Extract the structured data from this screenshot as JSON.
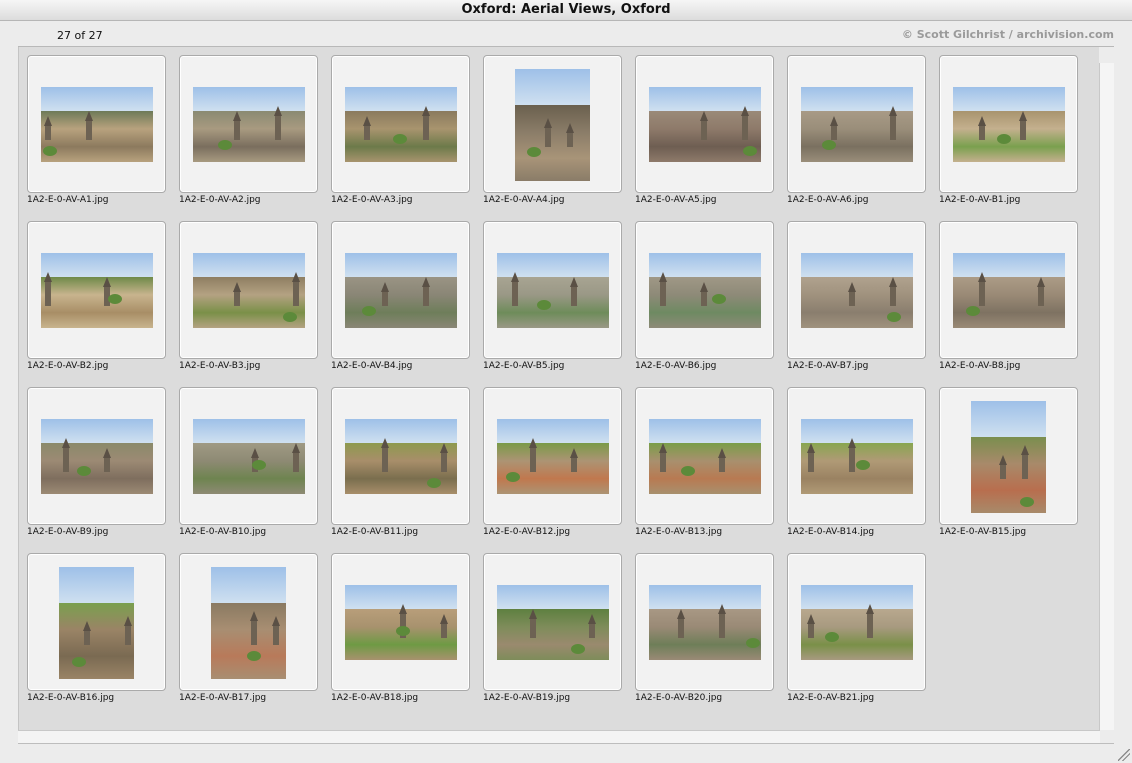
{
  "window": {
    "title": "Oxford: Aerial Views, Oxford"
  },
  "header": {
    "counter": "27 of 27",
    "copyright": "© Scott Gilchrist / archivision.com"
  },
  "slides": [
    {
      "name": "1A2-E-0-AV-A1.jpg",
      "orientation": "land",
      "palette": [
        "#b8a27e",
        "#8c7a5e",
        "#6d7a58"
      ]
    },
    {
      "name": "1A2-E-0-AV-A2.jpg",
      "orientation": "land",
      "palette": [
        "#a89a80",
        "#7a6e5e",
        "#8a8a72"
      ]
    },
    {
      "name": "1A2-E-0-AV-A3.jpg",
      "orientation": "land",
      "palette": [
        "#a8946e",
        "#6c7a4a",
        "#8a7a5e"
      ]
    },
    {
      "name": "1A2-E-0-AV-A4.jpg",
      "orientation": "port",
      "palette": [
        "#8a7c68",
        "#a89478",
        "#6a604e"
      ]
    },
    {
      "name": "1A2-E-0-AV-A5.jpg",
      "orientation": "land",
      "palette": [
        "#8e7a6a",
        "#6e5e52",
        "#9a8a78"
      ]
    },
    {
      "name": "1A2-E-0-AV-A6.jpg",
      "orientation": "land",
      "palette": [
        "#9a8e7a",
        "#7a7060",
        "#a89a86"
      ]
    },
    {
      "name": "1A2-E-0-AV-B1.jpg",
      "orientation": "land",
      "palette": [
        "#c4b08e",
        "#7aa04e",
        "#a8946e"
      ]
    },
    {
      "name": "1A2-E-0-AV-B2.jpg",
      "orientation": "land",
      "palette": [
        "#c8b48e",
        "#a88e66",
        "#6e8a48"
      ]
    },
    {
      "name": "1A2-E-0-AV-B3.jpg",
      "orientation": "land",
      "palette": [
        "#b4a282",
        "#7a9048",
        "#8e7e62"
      ]
    },
    {
      "name": "1A2-E-0-AV-B4.jpg",
      "orientation": "land",
      "palette": [
        "#8a8676",
        "#6e7e5a",
        "#9a9484"
      ]
    },
    {
      "name": "1A2-E-0-AV-B5.jpg",
      "orientation": "land",
      "palette": [
        "#9a9886",
        "#6e8c5a",
        "#a8a492"
      ]
    },
    {
      "name": "1A2-E-0-AV-B6.jpg",
      "orientation": "land",
      "palette": [
        "#8e8a78",
        "#6e8a62",
        "#a09886"
      ]
    },
    {
      "name": "1A2-E-0-AV-B7.jpg",
      "orientation": "land",
      "palette": [
        "#a0927e",
        "#8a7e6e",
        "#b0a28e"
      ]
    },
    {
      "name": "1A2-E-0-AV-B8.jpg",
      "orientation": "land",
      "palette": [
        "#9a8a76",
        "#7e7262",
        "#ac9c86"
      ]
    },
    {
      "name": "1A2-E-0-AV-B9.jpg",
      "orientation": "land",
      "palette": [
        "#9c8a74",
        "#7e6e5e",
        "#8a8a6a"
      ]
    },
    {
      "name": "1A2-E-0-AV-B10.jpg",
      "orientation": "land",
      "palette": [
        "#8e8a74",
        "#6e8450",
        "#a09a84"
      ]
    },
    {
      "name": "1A2-E-0-AV-B11.jpg",
      "orientation": "land",
      "palette": [
        "#a88e6a",
        "#7a6e4e",
        "#8e9a4e"
      ]
    },
    {
      "name": "1A2-E-0-AV-B12.jpg",
      "orientation": "land",
      "palette": [
        "#ac9474",
        "#c0784e",
        "#7a9a48"
      ]
    },
    {
      "name": "1A2-E-0-AV-B13.jpg",
      "orientation": "land",
      "palette": [
        "#a8906e",
        "#b87a52",
        "#7a9e48"
      ]
    },
    {
      "name": "1A2-E-0-AV-B14.jpg",
      "orientation": "land",
      "palette": [
        "#b09a76",
        "#9a8262",
        "#88a650"
      ]
    },
    {
      "name": "1A2-E-0-AV-B15.jpg",
      "orientation": "port",
      "palette": [
        "#a88a6a",
        "#b86e4e",
        "#7a8e4e"
      ]
    },
    {
      "name": "1A2-E-0-AV-B16.jpg",
      "orientation": "port",
      "palette": [
        "#9a8466",
        "#7a6a52",
        "#7aa04e"
      ]
    },
    {
      "name": "1A2-E-0-AV-B17.jpg",
      "orientation": "port",
      "palette": [
        "#a88e72",
        "#b87a5a",
        "#8a7a62"
      ]
    },
    {
      "name": "1A2-E-0-AV-B18.jpg",
      "orientation": "land",
      "palette": [
        "#a8926e",
        "#6e9a44",
        "#b89e7a"
      ]
    },
    {
      "name": "1A2-E-0-AV-B19.jpg",
      "orientation": "land",
      "palette": [
        "#7e8c5a",
        "#9a8a6e",
        "#5e8040"
      ]
    },
    {
      "name": "1A2-E-0-AV-B20.jpg",
      "orientation": "land",
      "palette": [
        "#9a8a76",
        "#6e7e58",
        "#a89884"
      ]
    },
    {
      "name": "1A2-E-0-AV-B21.jpg",
      "orientation": "land",
      "palette": [
        "#a89a80",
        "#7a9048",
        "#b8a88e"
      ]
    }
  ]
}
